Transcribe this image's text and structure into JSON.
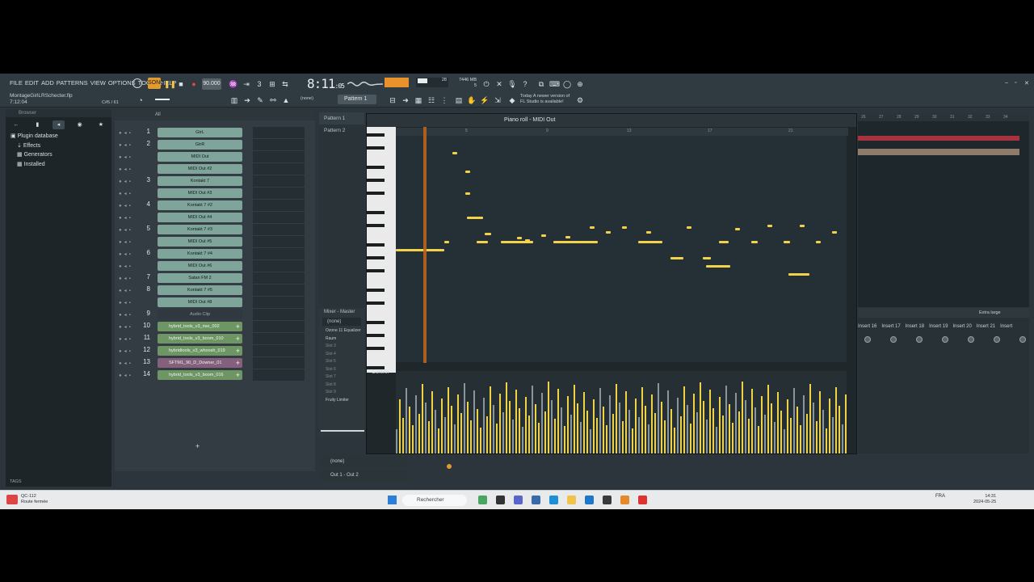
{
  "menu": [
    "FILE",
    "EDIT",
    "ADD",
    "PATTERNS",
    "VIEW",
    "OPTIONS",
    "TOOLS",
    "HELP"
  ],
  "project": {
    "file": "MontageGirlLRSchecter.flp",
    "time": "7:12:04",
    "key": "C#5 / 61"
  },
  "transport": {
    "tempo": "90.000",
    "song_time": "8:11",
    "song_time_small": ":05",
    "cpu": "28",
    "memory": "7446 MB",
    "poly": "5"
  },
  "toolbar": {
    "snap": "(none)",
    "pattern": "Pattern 1"
  },
  "news": {
    "line1": "Today  A newer version of",
    "line2": "FL Studio is available!"
  },
  "browser": {
    "title": "Browser",
    "filter": "All",
    "tree": [
      "Plugin database",
      "Effects",
      "Generators",
      "Installed"
    ],
    "tags": "TAGS"
  },
  "channels": [
    {
      "n": "1",
      "name": "GtrL",
      "kind": "green"
    },
    {
      "n": "2",
      "name": "GtrR",
      "kind": "green"
    },
    {
      "n": "",
      "name": "MIDI Out",
      "kind": "green"
    },
    {
      "n": "",
      "name": "MIDI Out #2",
      "kind": "green"
    },
    {
      "n": "3",
      "name": "Kontakt 7",
      "kind": "green"
    },
    {
      "n": "",
      "name": "MIDI Out #3",
      "kind": "green"
    },
    {
      "n": "4",
      "name": "Kontakt 7 #2",
      "kind": "green"
    },
    {
      "n": "",
      "name": "MIDI Out #4",
      "kind": "green"
    },
    {
      "n": "5",
      "name": "Kontakt 7 #3",
      "kind": "green"
    },
    {
      "n": "",
      "name": "MIDI Out #5",
      "kind": "green"
    },
    {
      "n": "6",
      "name": "Kontakt 7 #4",
      "kind": "green"
    },
    {
      "n": "",
      "name": "MIDI Out #6",
      "kind": "green"
    },
    {
      "n": "7",
      "name": "Satan FM 2",
      "kind": "green"
    },
    {
      "n": "8",
      "name": "Kontakt 7 #5",
      "kind": "green"
    },
    {
      "n": "",
      "name": "MIDI Out #8",
      "kind": "green"
    },
    {
      "n": "9",
      "name": "Audio Clip",
      "kind": "audio"
    },
    {
      "n": "10",
      "name": "hybrid_tools_v3_rise_002",
      "kind": "clip"
    },
    {
      "n": "11",
      "name": "hybrid_tools_v3_boom_010",
      "kind": "clip"
    },
    {
      "n": "12",
      "name": "hybridtools_v3_whoosh_019",
      "kind": "clip"
    },
    {
      "n": "13",
      "name": "SFTM1_90_D_Downer_01",
      "kind": "clip purple"
    },
    {
      "n": "14",
      "name": "hybrid_tools_v3_boom_016",
      "kind": "clip"
    }
  ],
  "patterns": [
    "Pattern 1",
    "Pattern 2"
  ],
  "mixer": {
    "title": "Mixer - Master",
    "preset": "(none)",
    "slots": [
      "Fruity Limiter"
    ],
    "slot1": "Ozone 11 Equalizer",
    "slot2": "Raum",
    "empty_slots": [
      "Slot 3",
      "Slot 4",
      "Slot 5",
      "Slot 6",
      "Slot 7",
      "Slot 8",
      "Slot 9"
    ]
  },
  "piano_roll": {
    "title": "Piano roll - MIDI Out",
    "control": "Control",
    "ruler": [
      "5",
      "9",
      "13",
      "17",
      "21"
    ]
  },
  "right_ruler": [
    "26",
    "27",
    "28",
    "29",
    "30",
    "31",
    "32",
    "33",
    "34"
  ],
  "mixer_right": {
    "preset": "Extra large",
    "inserts": [
      "Insert 16",
      "Insert 17",
      "Insert 18",
      "Insert 19",
      "Insert 20",
      "Insert 21",
      "Insert"
    ]
  },
  "footer": {
    "channel": "(none)",
    "output": "Out 1 - Out 2"
  },
  "taskbar": {
    "weather_line1": "QC-112",
    "weather_line2": "Route fermée",
    "search": "Rechercher",
    "lang": "FRA",
    "time": "14:31",
    "date": "2024-05-25"
  },
  "colors": {
    "accent": "#f2d24a",
    "playhead": "#b9651f",
    "channel": "#7fa59a",
    "clip": "#6d9664"
  }
}
